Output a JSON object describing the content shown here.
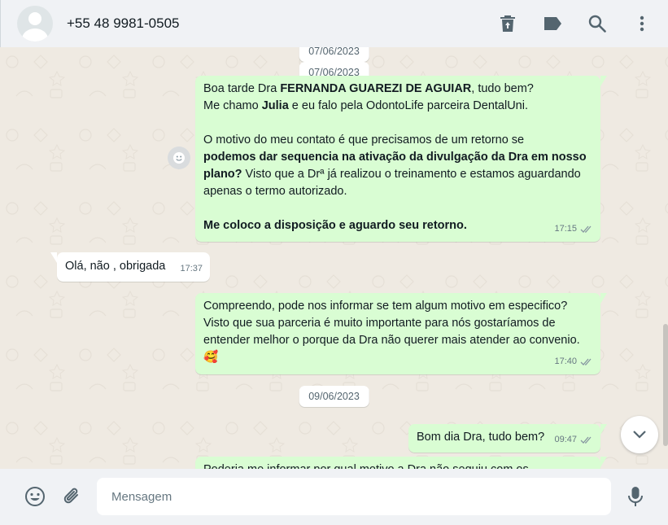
{
  "header": {
    "contact_name": "+55 48 9981-0505",
    "icons": [
      "delete-icon",
      "label-icon",
      "search-icon",
      "menu-icon"
    ]
  },
  "chat": {
    "dates": [
      "07/06/2023",
      "07/06/2023",
      "09/06/2023"
    ],
    "msg1": {
      "l1a": "Boa tarde Dra ",
      "l1b": "FERNANDA GUAREZI DE AGUIAR",
      "l1c": ", tudo bem?",
      "l2a": "Me chamo ",
      "l2b": "Julia",
      "l2c": " e eu falo pela OdontoLife parceira DentalUni.",
      "l3": "O motivo do meu contato é que precisamos de um retorno se",
      "l4b": "podemos dar sequencia na ativação da divulgação da Dra em nosso plano?",
      "l4c": " Visto que a Drª já realizou o treinamento e estamos aguardando apenas o termo autorizado.",
      "l5": "Me coloco a disposição e aguardo seu retorno.",
      "time": "17:15"
    },
    "msg2": {
      "text": "Olá, não , obrigada",
      "time": "17:37"
    },
    "msg3": {
      "text": "Compreendo, pode nos informar se tem algum motivo em especifico? Visto que sua parceria é muito importante para nós gostaríamos de entender melhor o porque da Dra não querer mais atender ao convenio.",
      "emoji": "🥰",
      "time": "17:40"
    },
    "msg4": {
      "text": "Bom dia Dra, tudo bem?",
      "time": "09:47"
    },
    "msg5": {
      "text": "Poderia me informar por qual motivo a Dra não seguiu com os"
    }
  },
  "footer": {
    "placeholder": "Mensagem"
  },
  "colors": {
    "outgoing": "#d9fdd3",
    "incoming": "#ffffff",
    "background": "#efeae2",
    "bar": "#f0f2f5",
    "tick": "#8696a0"
  }
}
